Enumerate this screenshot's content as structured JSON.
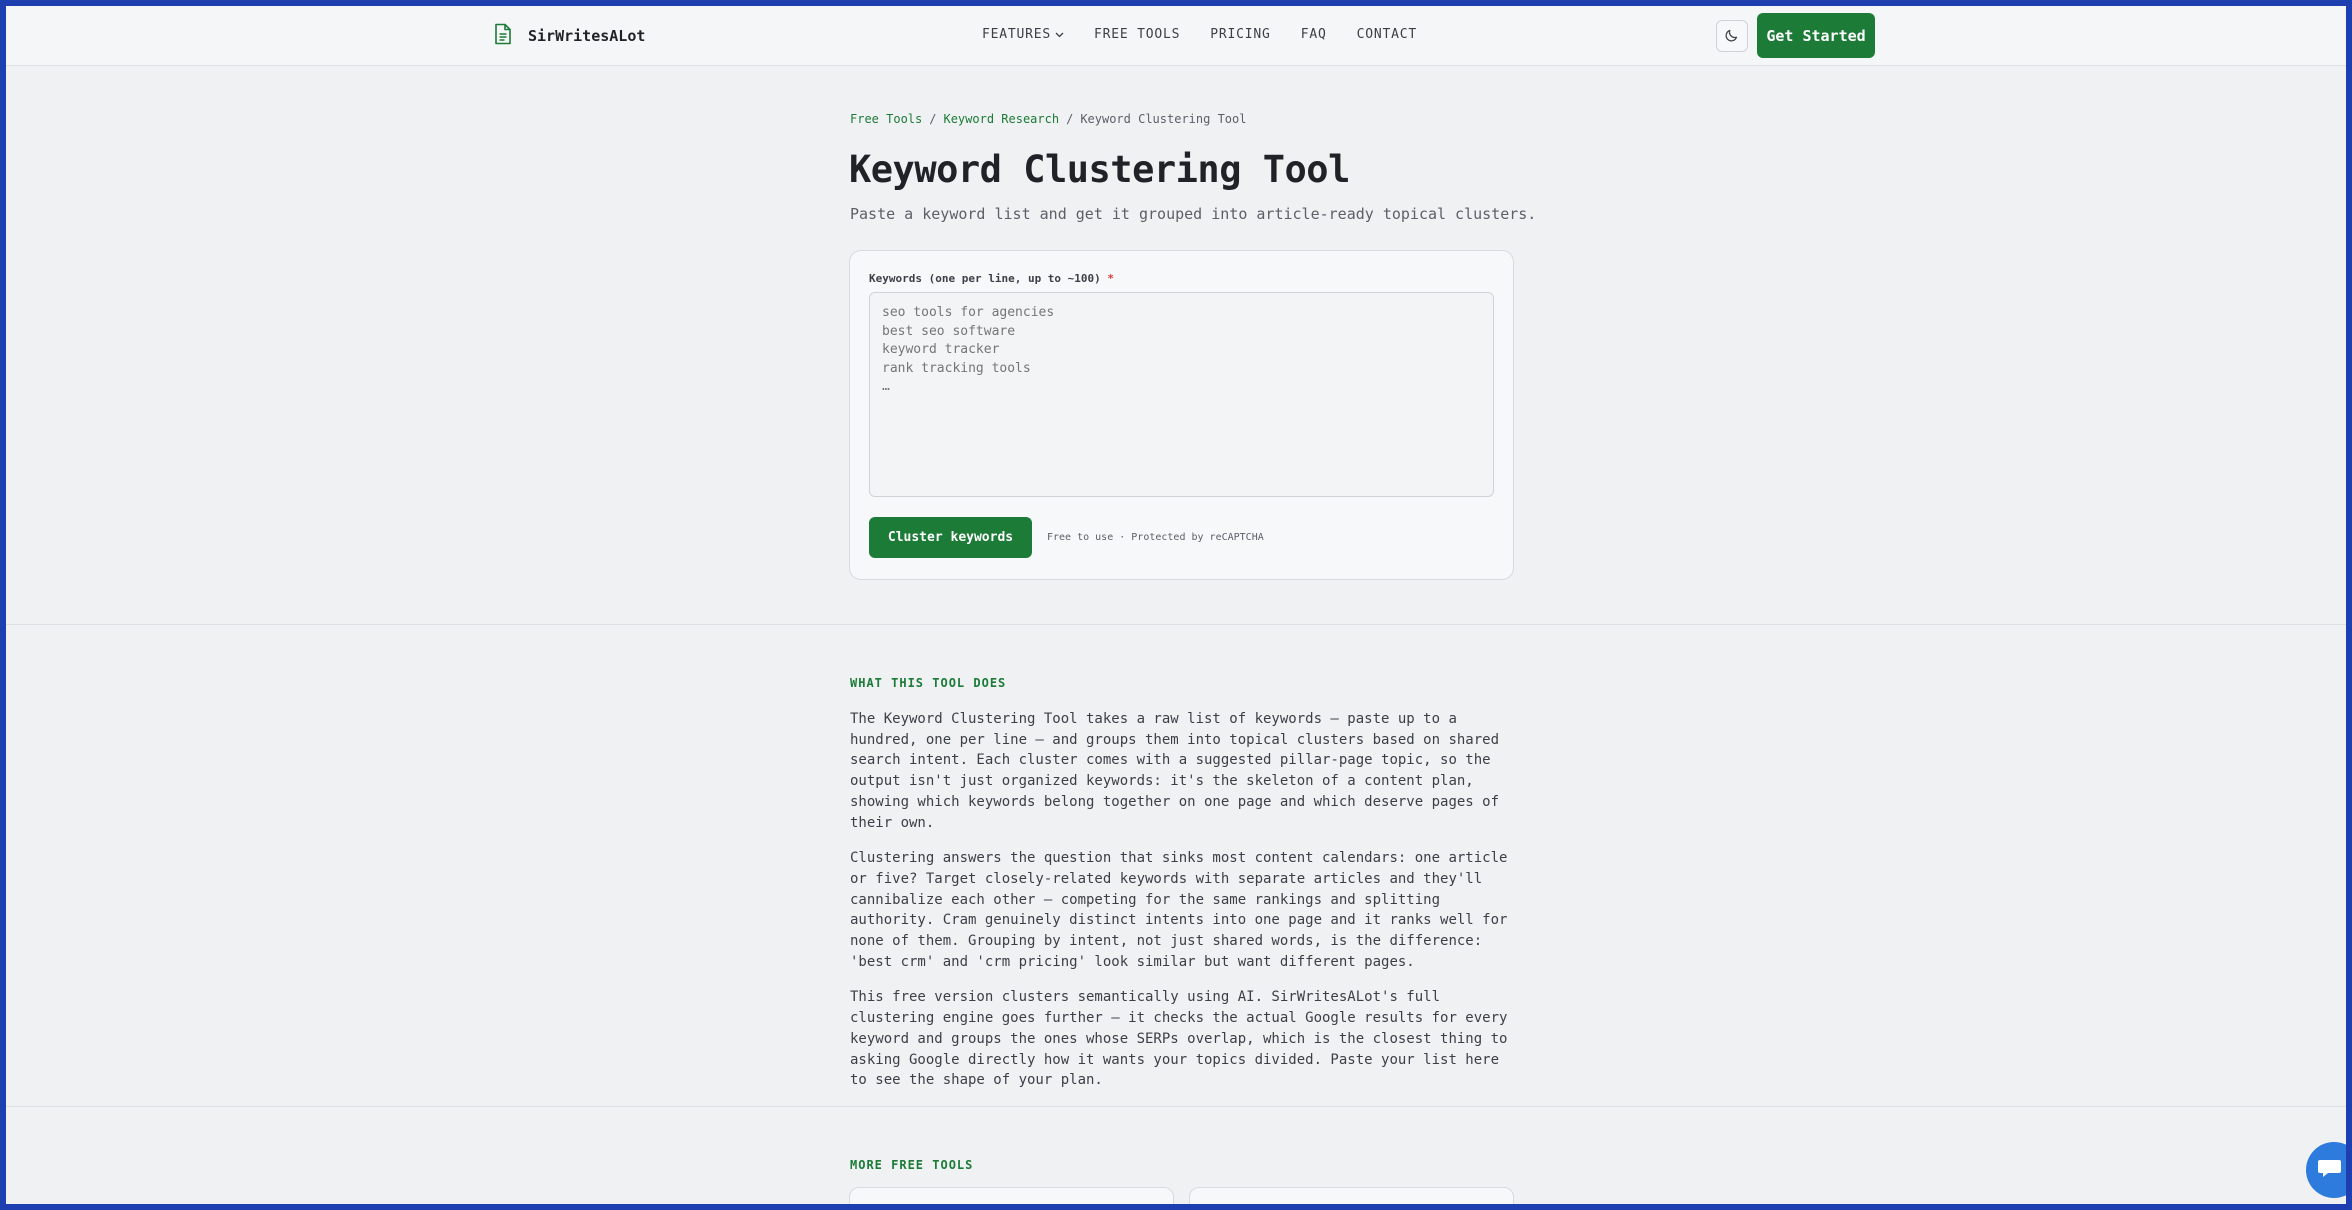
{
  "header": {
    "brand": "SirWritesALot",
    "nav": [
      {
        "label": "FEATURES"
      },
      {
        "label": "FREE TOOLS"
      },
      {
        "label": "PRICING"
      },
      {
        "label": "FAQ"
      },
      {
        "label": "CONTACT"
      }
    ],
    "theme_toggle_icon": "moon-icon",
    "cta_label": "Get Started"
  },
  "breadcrumb": {
    "items": [
      "Free Tools",
      "Keyword Research",
      "Keyword Clustering Tool"
    ],
    "separator": "/"
  },
  "hero": {
    "title": "Keyword Clustering Tool",
    "subtitle": "Paste a keyword list and get it grouped into article-ready topical clusters."
  },
  "form": {
    "label": "Keywords (one per line, up to ~100)",
    "required_marker": "*",
    "placeholder": "seo tools for agencies\nbest seo software\nkeyword tracker\nrank tracking tools\n…",
    "value": "",
    "submit_label": "Cluster keywords",
    "note": "Free to use · Protected by reCAPTCHA"
  },
  "about": {
    "eyebrow": "WHAT THIS TOOL DOES",
    "paragraphs": [
      "The Keyword Clustering Tool takes a raw list of keywords — paste up to a hundred, one per line — and groups them into topical clusters based on shared search intent. Each cluster comes with a suggested pillar-page topic, so the output isn't just organized keywords: it's the skeleton of a content plan, showing which keywords belong together on one page and which deserve pages of their own.",
      "Clustering answers the question that sinks most content calendars: one article or five? Target closely-related keywords with separate articles and they'll cannibalize each other — competing for the same rankings and splitting authority. Cram genuinely distinct intents into one page and it ranks well for none of them. Grouping by intent, not just shared words, is the difference: 'best crm' and 'crm pricing' look similar but want different pages.",
      "This free version clusters semantically using AI. SirWritesALot's full clustering engine goes further — it checks the actual Google results for every keyword and groups the ones whose SERPs overlap, which is the closest thing to asking Google directly how it wants your topics divided. Paste your list here to see the shape of your plan."
    ]
  },
  "more_tools": {
    "eyebrow": "MORE FREE TOOLS"
  },
  "colors": {
    "accent": "#1b7b37",
    "background": "#f0f1f3",
    "frame": "#1d3fb0",
    "chat_bubble": "#2d7bdc"
  },
  "icons": {
    "brand": "document-icon",
    "features_dropdown": "chevron-down-icon",
    "chat": "chat-bubble-icon"
  }
}
